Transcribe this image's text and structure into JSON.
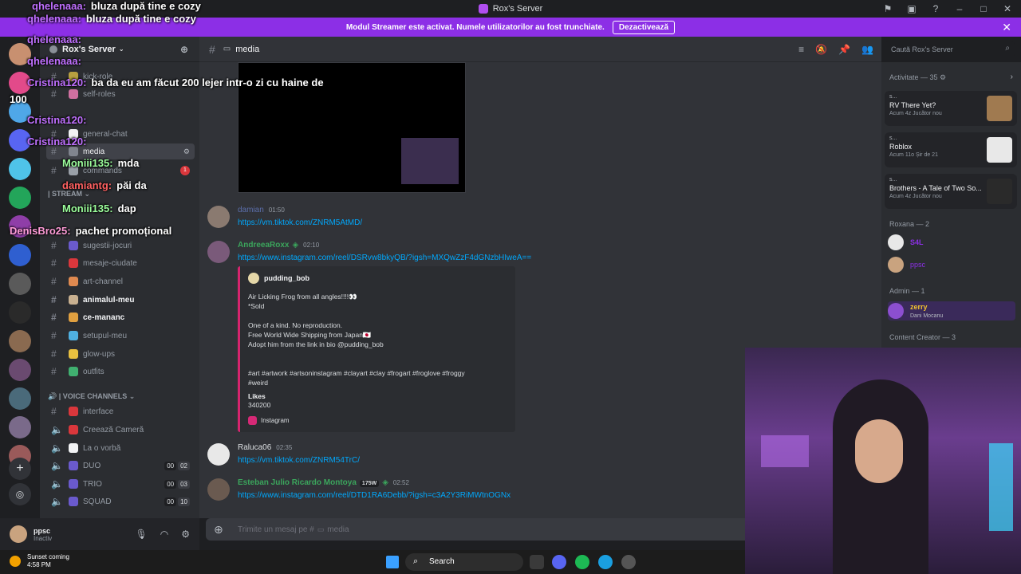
{
  "window": {
    "title": "Rox's Server"
  },
  "banner": {
    "text": "Modul Streamer este activat. Numele utilizatorilor au fost trunchiate.",
    "button": "Dezactivează"
  },
  "server": {
    "name": "Rox's Server"
  },
  "channels": [
    {
      "name": "kick-role",
      "icon": "sparkle-icon"
    },
    {
      "name": "self-roles",
      "icon": "rainbow-icon"
    },
    {
      "name": "general-chat",
      "icon": "speech-bubble-icon"
    },
    {
      "name": "media",
      "icon": "tv-icon"
    },
    {
      "name": "commands",
      "icon": "robot-icon",
      "badge": "1"
    },
    {
      "name": "sugestii-jocuri",
      "icon": "gamepad-icon"
    },
    {
      "name": "mesaje-ciudate",
      "icon": "question-icon"
    },
    {
      "name": "art-channel",
      "icon": "palette-icon"
    },
    {
      "name": "animalul-meu",
      "icon": "paw-icon"
    },
    {
      "name": "ce-mananc",
      "icon": "pizza-icon"
    },
    {
      "name": "setupul-meu",
      "icon": "monitor-icon"
    },
    {
      "name": "glow-ups",
      "icon": "sparkle-icon"
    },
    {
      "name": "outfits",
      "icon": "shirt-icon"
    }
  ],
  "categories": {
    "stream": "STREAM",
    "voice": "VOICE CHANNELS"
  },
  "voice_channels": [
    {
      "name": "interface",
      "icon": "phone-icon"
    },
    {
      "name": "Creează Cameră",
      "icon": "phone-icon"
    },
    {
      "name": "La o vorbă",
      "icon": "speech-bubble-icon"
    },
    {
      "name": "DUO",
      "icon": "gamepad-icon",
      "count": [
        "00",
        "02"
      ]
    },
    {
      "name": "TRIO",
      "icon": "gamepad-icon",
      "count": [
        "00",
        "03"
      ]
    },
    {
      "name": "SQUAD",
      "icon": "gamepad-icon",
      "count": [
        "00",
        "10"
      ]
    }
  ],
  "user": {
    "name": "ppsc",
    "status": "Inactiv"
  },
  "chat": {
    "channel": "media",
    "search_placeholder": "Caută Rox's Server",
    "input_placeholder": "Trimite un mesaj pe #",
    "input_channel": "media",
    "messages": [
      {
        "user": "damian",
        "time": "01:50",
        "link": "https://vm.tiktok.com/ZNRM5AtMD/",
        "color": "#5b6eaa"
      },
      {
        "user": "AndreeaRoxx",
        "time": "02:10",
        "link": "https://www.instagram.com/reel/DSRvw8bkyQB/?igsh=MXQwZzF4dGNzbHIweA==",
        "color": "#3ba55c"
      },
      {
        "user": "Raluca06",
        "time": "02:35",
        "link": "https://vm.tiktok.com/ZNRM54TrC/",
        "color": "#dbdee1"
      },
      {
        "user": "Esteban Julio Ricardo Montoya",
        "tag": "175W",
        "time": "02:52",
        "link": "https://www.instagram.com/reel/DTD1RA6Debb/?igsh=c3A2Y3RiMWtnOGNx",
        "color": "#3ba55c"
      }
    ],
    "embed": {
      "author": "pudding_bob",
      "lines": [
        "Air Licking Frog from all angles!!!!👀",
        "*Sold",
        "",
        "One of a kind. No reproduction.",
        "Free World Wide Shipping from Japan🇯🇵",
        "Adopt him from the link in bio @pudding_bob",
        "",
        "",
        "#art #artwork #artsoninstagram #clayart #clay #frogart #froglove #froggy",
        "#weird"
      ],
      "field_name": "Likes",
      "field_value": "340200",
      "footer": "Instagram"
    }
  },
  "members": {
    "activity_header": "Activitate — 35",
    "activities": [
      {
        "user": "s...",
        "title": "RV There Yet?",
        "meta": "Acum 4z  Jucător nou"
      },
      {
        "user": "s...",
        "title": "Roblox",
        "meta": "Acum 11o  Șir de 21"
      },
      {
        "user": "s...",
        "title": "Brothers - A Tale of Two So...",
        "meta": "Acum 4z  Jucător nou"
      }
    ],
    "roles": [
      {
        "name": "Roxana — 2"
      },
      {
        "name": "Admin — 1"
      },
      {
        "name": "Content Creator — 3"
      }
    ],
    "roxana_members": [
      "S4L",
      "ppsc"
    ],
    "admin_members": [
      {
        "name": "zerry",
        "sub": "Dani Mocanu"
      }
    ]
  },
  "stream_chat": [
    {
      "user": "qhelenaaa:",
      "text": "bluza după tine e cozy"
    },
    {
      "user": "qhelenaaa:",
      "text": ""
    },
    {
      "user": "qhelenaaa:",
      "text": ""
    },
    {
      "user": "Cristina120:",
      "text": "ba da eu am făcut 200 lejer intr-o zi cu haine de"
    },
    {
      "user": "",
      "text": "100"
    },
    {
      "user": "Cristina120:",
      "text": ""
    },
    {
      "user": "Cristina120:",
      "text": ""
    },
    {
      "user": "Moniii135:",
      "text": "mda"
    },
    {
      "user": "damiantg:",
      "text": "păi da"
    },
    {
      "user": "Moniii135:",
      "text": "dap"
    },
    {
      "user": "DenisBro25:",
      "text": "pachet promoțional"
    }
  ],
  "taskbar": {
    "weather_title": "Sunset coming",
    "weather_time": "4:58 PM",
    "search": "Search"
  }
}
